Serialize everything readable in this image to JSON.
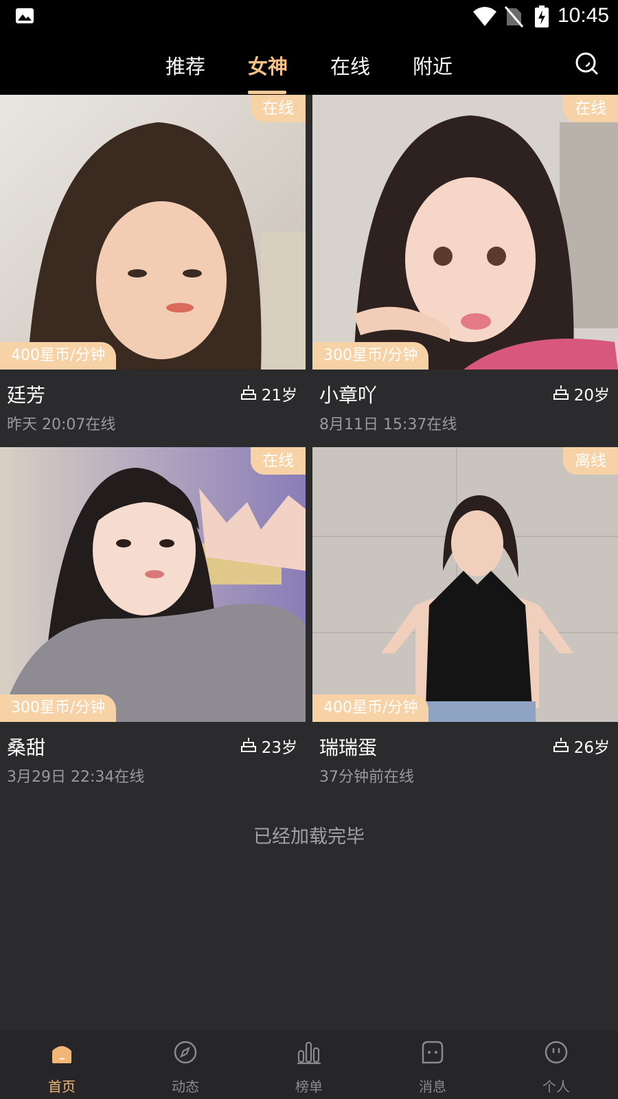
{
  "status_bar": {
    "time": "10:45",
    "icons": [
      "gallery-icon",
      "wifi-icon",
      "no-sim-icon",
      "battery-charging-icon"
    ]
  },
  "top_nav": {
    "tabs": [
      {
        "label": "推荐",
        "active": false
      },
      {
        "label": "女神",
        "active": true
      },
      {
        "label": "在线",
        "active": false
      },
      {
        "label": "附近",
        "active": false
      }
    ],
    "accent_color": "#f3c088"
  },
  "cards": [
    {
      "name": "廷芳",
      "age": "21岁",
      "status": "在线",
      "price": "400星币/分钟",
      "last_online": "昨天 20:07在线"
    },
    {
      "name": "小章吖",
      "age": "20岁",
      "status": "在线",
      "price": "300星币/分钟",
      "last_online": "8月11日 15:37在线"
    },
    {
      "name": "桑甜",
      "age": "23岁",
      "status": "在线",
      "price": "300星币/分钟",
      "last_online": "3月29日 22:34在线"
    },
    {
      "name": "瑞瑞蛋",
      "age": "26岁",
      "status": "离线",
      "price": "400星币/分钟",
      "last_online": "37分钟前在线"
    }
  ],
  "footer_message": "已经加载完毕",
  "bottom_nav": {
    "items": [
      {
        "label": "首页",
        "icon": "home-icon",
        "active": true
      },
      {
        "label": "动态",
        "icon": "compass-icon",
        "active": false
      },
      {
        "label": "榜单",
        "icon": "ranking-icon",
        "active": false
      },
      {
        "label": "消息",
        "icon": "message-icon",
        "active": false
      },
      {
        "label": "个人",
        "icon": "profile-icon",
        "active": false
      }
    ]
  },
  "colors": {
    "tag_background": "#f7d2a7",
    "page_background": "#2b2b2d",
    "bar_background": "#000000"
  }
}
